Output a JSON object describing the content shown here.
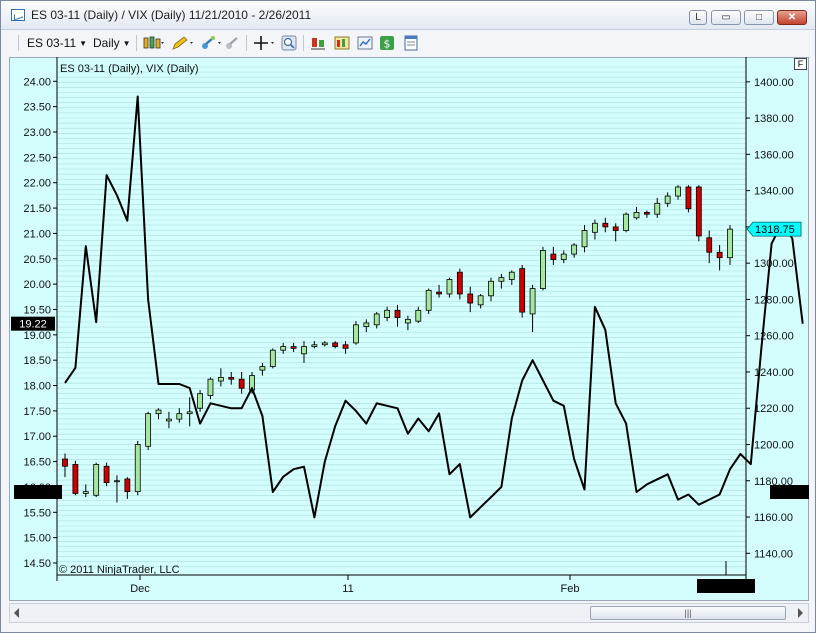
{
  "window": {
    "title": "ES 03-11 (Daily) / VIX (Daily)  11/21/2010 - 2/26/2011",
    "buttons": {
      "link": "L",
      "minimize": "▭",
      "maximize": "□",
      "close": "✕"
    }
  },
  "toolbar": {
    "instrument": "ES 03-11",
    "period": "Daily",
    "icons": [
      "bar-style-icon",
      "drawing-pencil-icon",
      "magnet-icon",
      "zoom-out-icon",
      "crosshair-icon",
      "zoom-icon",
      "indicators-icon",
      "strategies-icon",
      "chart-properties-icon",
      "dollar-icon",
      "data-box-icon"
    ]
  },
  "chart": {
    "label": "ES 03-11 (Daily), VIX (Daily)",
    "copyright": "© 2011 NinjaTrader, LLC",
    "float_button": "F",
    "left_axis_label": "19.22",
    "right_axis_label": "1318.75",
    "colors": {
      "background": "#d4fefe",
      "gridline": "#a9dcdc",
      "up_candle": "#a7e8a0",
      "down_candle": "#cc0000",
      "vix_line": "#000000",
      "marker": "#00ffff"
    }
  },
  "chart_data": {
    "type": "candlestick+line",
    "title": "ES 03-11 (Daily), VIX (Daily)",
    "x_ticks": [
      "Dec",
      "11",
      "Feb"
    ],
    "left_axis": {
      "series": "VIX (Daily)",
      "ylim": [
        14.5,
        24.0
      ],
      "ticks": [
        "24.00",
        "23.50",
        "23.00",
        "22.50",
        "22.00",
        "21.50",
        "21.00",
        "20.50",
        "20.00",
        "19.50",
        "19.00",
        "18.50",
        "18.00",
        "17.50",
        "17.00",
        "16.50",
        "16.00",
        "15.50",
        "15.00",
        "14.50"
      ],
      "last_value": 19.22
    },
    "right_axis": {
      "series": "ES 03-11 (Daily)",
      "ylim": [
        1130,
        1400
      ],
      "ticks": [
        "1400.00",
        "1380.00",
        "1360.00",
        "1340.00",
        "1320.00",
        "1300.00",
        "1280.00",
        "1260.00",
        "1240.00",
        "1220.00",
        "1200.00",
        "1180.00",
        "1160.00",
        "1140.00"
      ],
      "last_value": 1318.75
    },
    "vix": [
      18.05,
      18.35,
      20.75,
      19.25,
      22.15,
      21.75,
      21.25,
      23.7,
      19.7,
      18.03,
      18.03,
      18.03,
      17.95,
      17.25,
      17.65,
      17.6,
      17.55,
      17.55,
      17.95,
      17.4,
      15.9,
      16.2,
      16.35,
      16.4,
      15.4,
      16.5,
      17.2,
      17.7,
      17.5,
      17.25,
      17.65,
      17.6,
      17.55,
      17.05,
      17.35,
      17.1,
      17.45,
      16.25,
      16.45,
      15.4,
      15.6,
      15.8,
      16.0,
      17.35,
      18.1,
      18.5,
      18.1,
      17.7,
      17.6,
      16.55,
      15.95,
      19.55,
      19.1,
      17.65,
      17.25,
      15.9,
      16.05,
      16.15,
      16.25,
      15.75,
      15.85,
      15.65,
      15.75,
      15.85,
      16.35,
      16.65,
      16.45,
      18.7,
      20.8,
      21.2,
      20.9,
      19.22
    ],
    "es": [
      {
        "o": 1192,
        "h": 1195,
        "l": 1182,
        "c": 1188
      },
      {
        "o": 1189,
        "h": 1191,
        "l": 1172,
        "c": 1173
      },
      {
        "o": 1173,
        "h": 1178,
        "l": 1171,
        "c": 1174
      },
      {
        "o": 1172,
        "h": 1190,
        "l": 1171,
        "c": 1189
      },
      {
        "o": 1188,
        "h": 1190,
        "l": 1177,
        "c": 1179
      },
      {
        "o": 1180,
        "h": 1183,
        "l": 1168,
        "c": 1180
      },
      {
        "o": 1181,
        "h": 1182,
        "l": 1170,
        "c": 1174
      },
      {
        "o": 1174,
        "h": 1202,
        "l": 1172,
        "c": 1200
      },
      {
        "o": 1199,
        "h": 1218,
        "l": 1197,
        "c": 1217
      },
      {
        "o": 1217,
        "h": 1220,
        "l": 1214,
        "c": 1219
      },
      {
        "o": 1213,
        "h": 1218,
        "l": 1209,
        "c": 1214
      },
      {
        "o": 1214,
        "h": 1220,
        "l": 1212,
        "c": 1217
      },
      {
        "o": 1217,
        "h": 1226,
        "l": 1210,
        "c": 1218
      },
      {
        "o": 1220,
        "h": 1230,
        "l": 1218,
        "c": 1228
      },
      {
        "o": 1227,
        "h": 1237,
        "l": 1225,
        "c": 1236
      },
      {
        "o": 1235,
        "h": 1242,
        "l": 1232,
        "c": 1237
      },
      {
        "o": 1237,
        "h": 1240,
        "l": 1233,
        "c": 1236
      },
      {
        "o": 1236,
        "h": 1240,
        "l": 1228,
        "c": 1231
      },
      {
        "o": 1230,
        "h": 1240,
        "l": 1228,
        "c": 1238
      },
      {
        "o": 1241,
        "h": 1245,
        "l": 1238,
        "c": 1243
      },
      {
        "o": 1243,
        "h": 1253,
        "l": 1242,
        "c": 1252
      },
      {
        "o": 1252,
        "h": 1256,
        "l": 1250,
        "c": 1254
      },
      {
        "o": 1254,
        "h": 1256,
        "l": 1251,
        "c": 1253
      },
      {
        "o": 1250,
        "h": 1257,
        "l": 1245,
        "c": 1254
      },
      {
        "o": 1254,
        "h": 1257,
        "l": 1253,
        "c": 1255
      },
      {
        "o": 1255,
        "h": 1257,
        "l": 1254,
        "c": 1256
      },
      {
        "o": 1256,
        "h": 1257,
        "l": 1253,
        "c": 1254
      },
      {
        "o": 1255,
        "h": 1257,
        "l": 1250,
        "c": 1253
      },
      {
        "o": 1256,
        "h": 1268,
        "l": 1255,
        "c": 1266
      },
      {
        "o": 1265,
        "h": 1269,
        "l": 1262,
        "c": 1267
      },
      {
        "o": 1266,
        "h": 1273,
        "l": 1264,
        "c": 1272
      },
      {
        "o": 1270,
        "h": 1276,
        "l": 1268,
        "c": 1274
      },
      {
        "o": 1274,
        "h": 1277,
        "l": 1265,
        "c": 1270
      },
      {
        "o": 1267,
        "h": 1271,
        "l": 1263,
        "c": 1269
      },
      {
        "o": 1268,
        "h": 1276,
        "l": 1267,
        "c": 1274
      },
      {
        "o": 1274,
        "h": 1286,
        "l": 1272,
        "c": 1285
      },
      {
        "o": 1284,
        "h": 1288,
        "l": 1281,
        "c": 1283
      },
      {
        "o": 1283,
        "h": 1292,
        "l": 1281,
        "c": 1291
      },
      {
        "o": 1295,
        "h": 1297,
        "l": 1280,
        "c": 1283
      },
      {
        "o": 1283,
        "h": 1287,
        "l": 1273,
        "c": 1278
      },
      {
        "o": 1277,
        "h": 1283,
        "l": 1275,
        "c": 1282
      },
      {
        "o": 1282,
        "h": 1292,
        "l": 1279,
        "c": 1290
      },
      {
        "o": 1290,
        "h": 1294,
        "l": 1286,
        "c": 1292
      },
      {
        "o": 1291,
        "h": 1296,
        "l": 1288,
        "c": 1295
      },
      {
        "o": 1297,
        "h": 1299,
        "l": 1270,
        "c": 1273
      },
      {
        "o": 1272,
        "h": 1288,
        "l": 1262,
        "c": 1286
      },
      {
        "o": 1286,
        "h": 1309,
        "l": 1285,
        "c": 1307
      },
      {
        "o": 1305,
        "h": 1309,
        "l": 1299,
        "c": 1302
      },
      {
        "o": 1302,
        "h": 1307,
        "l": 1300,
        "c": 1305
      },
      {
        "o": 1305,
        "h": 1311,
        "l": 1303,
        "c": 1310
      },
      {
        "o": 1309,
        "h": 1321,
        "l": 1306,
        "c": 1318
      },
      {
        "o": 1317,
        "h": 1324,
        "l": 1313,
        "c": 1322
      },
      {
        "o": 1322,
        "h": 1325,
        "l": 1317,
        "c": 1320
      },
      {
        "o": 1320,
        "h": 1322,
        "l": 1312,
        "c": 1318
      },
      {
        "o": 1318,
        "h": 1328,
        "l": 1317,
        "c": 1327
      },
      {
        "o": 1325,
        "h": 1331,
        "l": 1324,
        "c": 1328
      },
      {
        "o": 1328,
        "h": 1329,
        "l": 1325,
        "c": 1327
      },
      {
        "o": 1327,
        "h": 1336,
        "l": 1325,
        "c": 1333
      },
      {
        "o": 1333,
        "h": 1339,
        "l": 1331,
        "c": 1337
      },
      {
        "o": 1337,
        "h": 1343,
        "l": 1335,
        "c": 1342
      },
      {
        "o": 1342,
        "h": 1343,
        "l": 1328,
        "c": 1330
      },
      {
        "o": 1342,
        "h": 1343,
        "l": 1312,
        "c": 1315
      },
      {
        "o": 1314,
        "h": 1318,
        "l": 1300,
        "c": 1306
      },
      {
        "o": 1306,
        "h": 1310,
        "l": 1296,
        "c": 1303
      },
      {
        "o": 1303,
        "h": 1321,
        "l": 1299,
        "c": 1318.75
      }
    ],
    "vix_legend": "VIX (Daily)",
    "es_legend": "ES 03-11 (Daily)"
  }
}
